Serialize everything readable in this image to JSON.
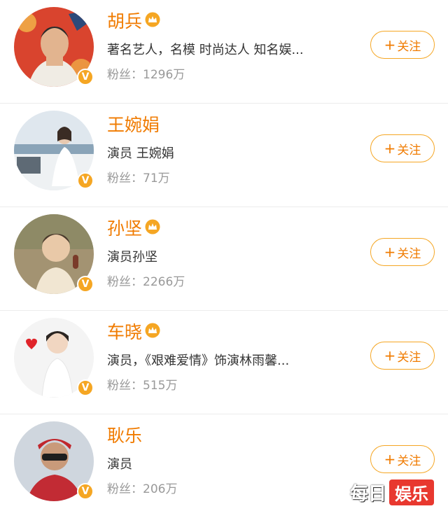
{
  "users": [
    {
      "name": "胡兵",
      "crown": true,
      "description": "著名艺人，名模 时尚达人 知名娱...",
      "fans": "粉丝：1296万",
      "follow": "关注",
      "avatar_icon": "avatar-hu-bing"
    },
    {
      "name": "王婉娟",
      "crown": false,
      "description": "演员 王婉娟",
      "fans": "粉丝：71万",
      "follow": "关注",
      "avatar_icon": "avatar-wang-wanjuan"
    },
    {
      "name": "孙坚",
      "crown": true,
      "description": "演员孙坚",
      "fans": "粉丝：2266万",
      "follow": "关注",
      "avatar_icon": "avatar-sun-jian"
    },
    {
      "name": "车晓",
      "crown": true,
      "description": "演员，《艰难爱情》饰演林雨馨...",
      "fans": "粉丝：515万",
      "follow": "关注",
      "avatar_icon": "avatar-che-xiao"
    },
    {
      "name": "耿乐",
      "crown": false,
      "description": "演员",
      "fans": "粉丝：206万",
      "follow": "关注",
      "avatar_icon": "avatar-geng-le"
    }
  ],
  "verified_badge": "V",
  "follow_plus": "+",
  "watermark": {
    "part1": "每日",
    "part2": "娱乐"
  },
  "colors": {
    "accent": "#f07b00",
    "badge": "#f5a623",
    "watermark_red": "#e8382f"
  }
}
